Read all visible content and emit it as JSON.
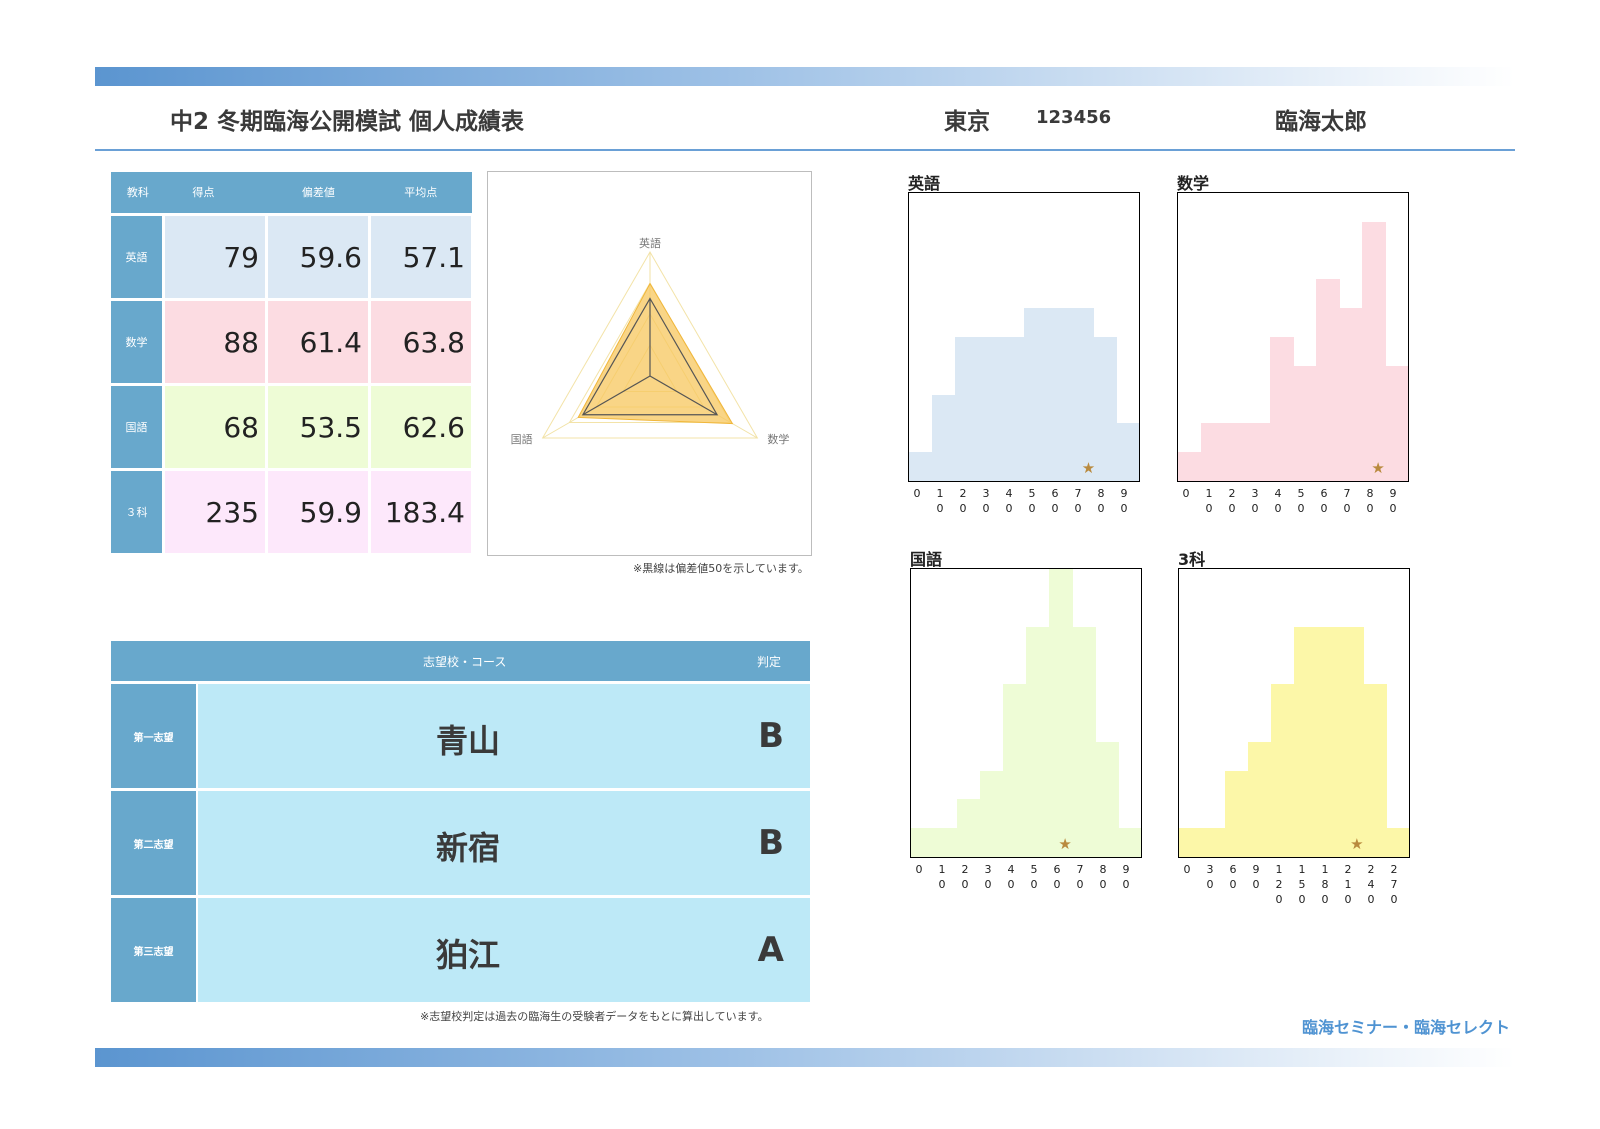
{
  "header": {
    "title": "中2 冬期臨海公開模試 個人成績表",
    "region": "東京",
    "student_id": "123456",
    "student_name": "臨海太郎"
  },
  "scores": {
    "columns": [
      "教科",
      "得点",
      "偏差値",
      "平均点"
    ],
    "rows": [
      {
        "subject": "英語",
        "score": "79",
        "deviation": "59.6",
        "average": "57.1",
        "color": "#dbe8f4"
      },
      {
        "subject": "数学",
        "score": "88",
        "deviation": "61.4",
        "average": "63.8",
        "color": "#fcdce2"
      },
      {
        "subject": "国語",
        "score": "68",
        "deviation": "53.5",
        "average": "62.6",
        "color": "#eefcd6"
      },
      {
        "subject": "３科",
        "score": "235",
        "deviation": "59.9",
        "average": "183.4",
        "color": "#fde8fb"
      }
    ]
  },
  "radar": {
    "labels": [
      "英語",
      "数学",
      "国語"
    ],
    "deviation": [
      59.6,
      61.4,
      53.5
    ],
    "baseline": 50,
    "range": [
      0,
      80
    ],
    "fill_color": "#f7c75d",
    "note": "※黒線は偏差値50を示しています。"
  },
  "preferences": {
    "header_school": "志望校・コース",
    "header_grade": "判定",
    "rows": [
      {
        "label": "第一志望",
        "school": "青山",
        "grade": "B"
      },
      {
        "label": "第二志望",
        "school": "新宿",
        "grade": "B"
      },
      {
        "label": "第三志望",
        "school": "狛江",
        "grade": "A"
      }
    ],
    "note": "※志望校判定は過去の臨海生の受験者データをもとに算出しています。"
  },
  "chart_data": [
    {
      "type": "bar",
      "title": "英語",
      "color": "#dbe8f4",
      "x_ticks": [
        "0",
        "10",
        "20",
        "30",
        "40",
        "50",
        "60",
        "70",
        "80",
        "90"
      ],
      "values": [
        1,
        3,
        5,
        5,
        5,
        6,
        6,
        6,
        5,
        2
      ],
      "ylim": [
        0,
        10
      ],
      "marker_x": 79
    },
    {
      "type": "bar",
      "title": "数学",
      "color": "#fcdce2",
      "x_ticks": [
        "0",
        "10",
        "20",
        "30",
        "40",
        "50",
        "60",
        "70",
        "80",
        "90"
      ],
      "values": [
        1,
        2,
        2,
        2,
        5,
        4,
        7,
        6,
        9,
        4
      ],
      "ylim": [
        0,
        10
      ],
      "marker_x": 88
    },
    {
      "type": "bar",
      "title": "国語",
      "color": "#eefcd6",
      "x_ticks": [
        "0",
        "10",
        "20",
        "30",
        "40",
        "50",
        "60",
        "70",
        "80",
        "90"
      ],
      "values": [
        1,
        1,
        2,
        3,
        6,
        8,
        10,
        8,
        4,
        1
      ],
      "ylim": [
        0,
        10
      ],
      "marker_x": 68
    },
    {
      "type": "bar",
      "title": "3科",
      "color": "#fcf7a8",
      "x_ticks": [
        "0",
        "30",
        "60",
        "90",
        "120",
        "150",
        "180",
        "210",
        "240",
        "270"
      ],
      "values": [
        1,
        1,
        3,
        4,
        6,
        8,
        8,
        8,
        6,
        1
      ],
      "ylim": [
        0,
        10
      ],
      "marker_x": 235
    }
  ],
  "footer": {
    "brand": "臨海セミナー・臨海セレクト"
  }
}
